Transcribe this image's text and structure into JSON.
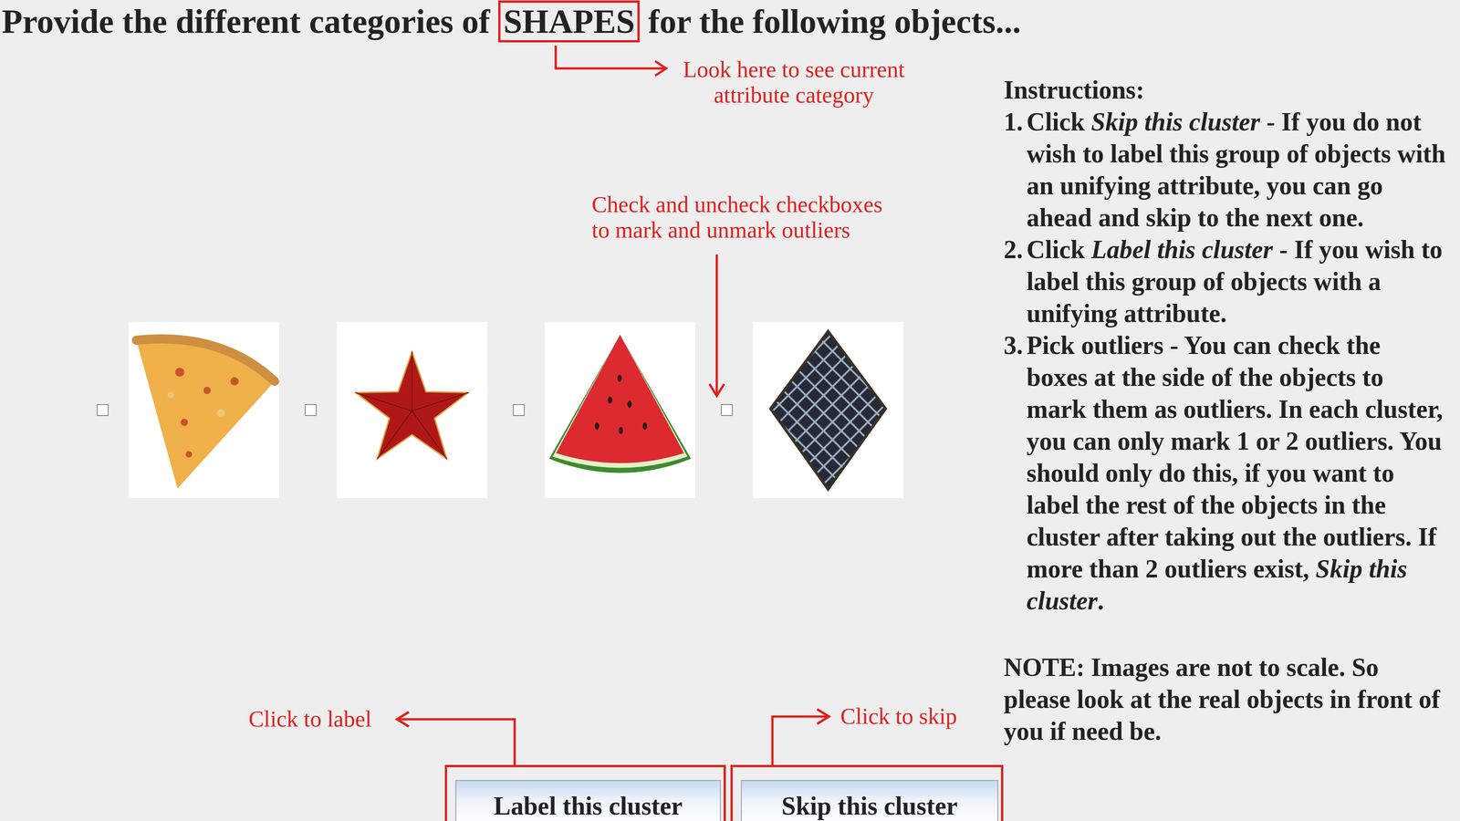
{
  "title": {
    "prefix": "Provide the different categories of ",
    "attribute": "SHAPES",
    "suffix": " for the following objects..."
  },
  "annotations": {
    "attribute": [
      "Look here to see current",
      "attribute category"
    ],
    "checkboxes": [
      "Check and uncheck checkboxes",
      "to mark and unmark outliers"
    ]
  },
  "objects": [
    {
      "kind": "pizza-slice",
      "checked": false
    },
    {
      "kind": "star",
      "checked": false
    },
    {
      "kind": "watermelon",
      "checked": false
    },
    {
      "kind": "rhombus",
      "checked": false
    }
  ],
  "instructions": {
    "heading": "Instructions:",
    "items": [
      {
        "number": "1.",
        "segments": [
          {
            "text": "Click ",
            "italic": false
          },
          {
            "text": "Skip this cluster",
            "italic": true
          },
          {
            "text": " - If you do not wish to label this group of objects with an unifying attribute, you can go ahead and skip to the next one.",
            "italic": false
          }
        ]
      },
      {
        "number": "2.",
        "segments": [
          {
            "text": "Click ",
            "italic": false
          },
          {
            "text": "Label this cluster",
            "italic": true
          },
          {
            "text": " - If you wish to label this group of objects with a unifying attribute.",
            "italic": false
          }
        ]
      },
      {
        "number": "3.",
        "segments": [
          {
            "text": "Pick outliers - You can check the boxes at the side of the objects to mark them as outliers. In each cluster, you can only mark 1 or 2 outliers. You should only do this, if you want to label the rest of the objects in the cluster after taking out the outliers. If more than 2 outliers exist, ",
            "italic": false
          },
          {
            "text": "Skip this cluster",
            "italic": true
          },
          {
            "text": ".",
            "italic": false
          }
        ]
      }
    ]
  },
  "note": "NOTE: Images are not to scale. So please look at the real objects in front of you if need be.",
  "buttons": [
    {
      "label": "Label this cluster",
      "annotation": "Click to label"
    },
    {
      "label": "Skip this cluster",
      "annotation": "Click to skip"
    }
  ]
}
